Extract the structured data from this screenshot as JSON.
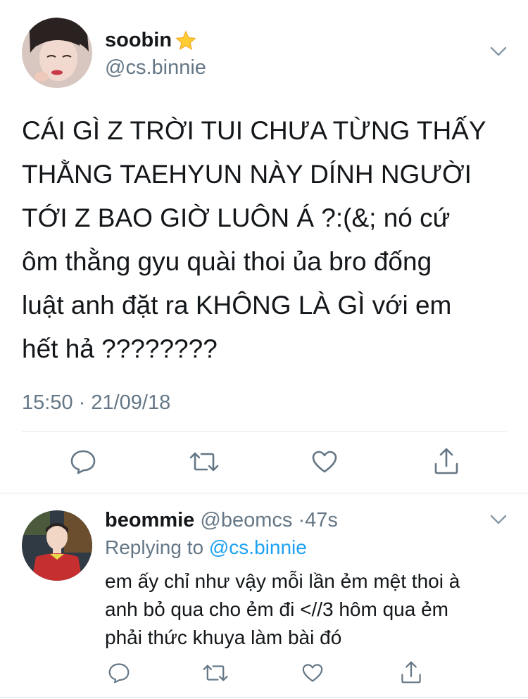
{
  "main_tweet": {
    "display_name": "soobin",
    "name_emoji": "star",
    "handle": "@cs.binnie",
    "text_lines": [
      "CÁI GÌ Z TRỜI TUI CHƯA TỪNG THẤY",
      "THẰNG TAEHYUN NÀY DÍNH NGƯỜI",
      "TỚI Z BAO GIỜ LUÔN Á ?:(&; nó cứ",
      "ôm thằng gyu quài thoi ủa bro đống",
      "luật anh đặt ra KHÔNG LÀ GÌ với em",
      "hết hả ????????"
    ],
    "timestamp": "15:50 · 21/09/18"
  },
  "actions": [
    "reply-icon",
    "retweet-icon",
    "like-icon",
    "share-icon"
  ],
  "reply_tweet": {
    "display_name": "beommie",
    "handle": "@beomcs",
    "dot": "·",
    "time_ago": "47s",
    "replying_prefix": "Replying to",
    "replying_handle": "@cs.binnie",
    "text_lines": [
      "em ấy chỉ như vậy mỗi lần ẻm mệt thoi à",
      "anh bỏ qua cho ẻm đi <//3 hôm qua ẻm",
      "phải thức khuya làm bài đó"
    ]
  },
  "colors": {
    "text": "#14171a",
    "secondary": "#657786",
    "link": "#1da1f2",
    "divider": "#e1e8ed"
  }
}
